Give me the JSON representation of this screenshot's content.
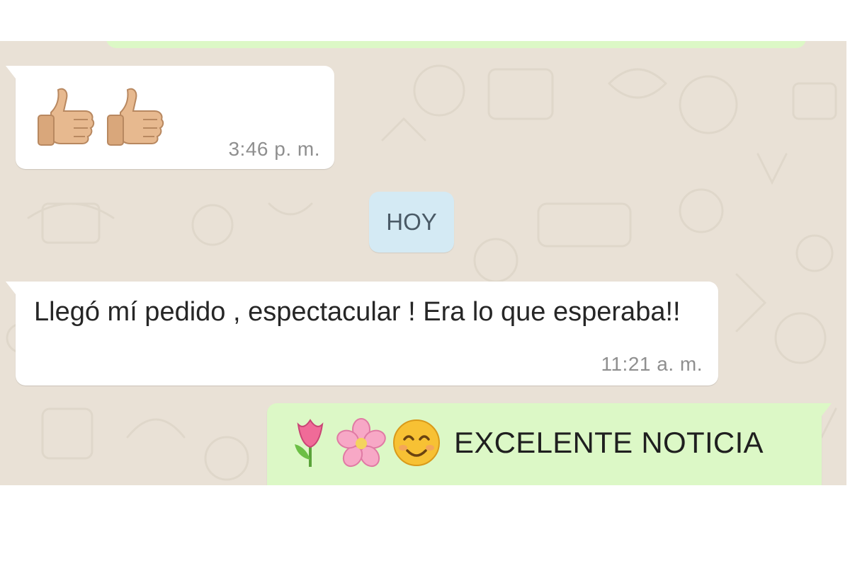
{
  "date_separator": "HOY",
  "messages": [
    {
      "direction": "incoming",
      "content_icons": [
        "thumbs-up-icon",
        "thumbs-up-icon"
      ],
      "time": "3:46 p. m."
    },
    {
      "direction": "incoming",
      "text": "Llegó mí pedido , espectacular ! Era lo que esperaba!!",
      "time": "11:21 a. m."
    },
    {
      "direction": "outgoing",
      "content_icons": [
        "tulip-icon",
        "cherry-blossom-icon",
        "smiling-face-icon"
      ],
      "text": "EXCELENTE NOTICIA"
    }
  ],
  "colors": {
    "chat_background": "#e9e1d6",
    "incoming_bubble": "#ffffff",
    "outgoing_bubble": "#dcf8c6",
    "date_chip": "#d4eaf4",
    "timestamp": "#8f8f8f"
  }
}
